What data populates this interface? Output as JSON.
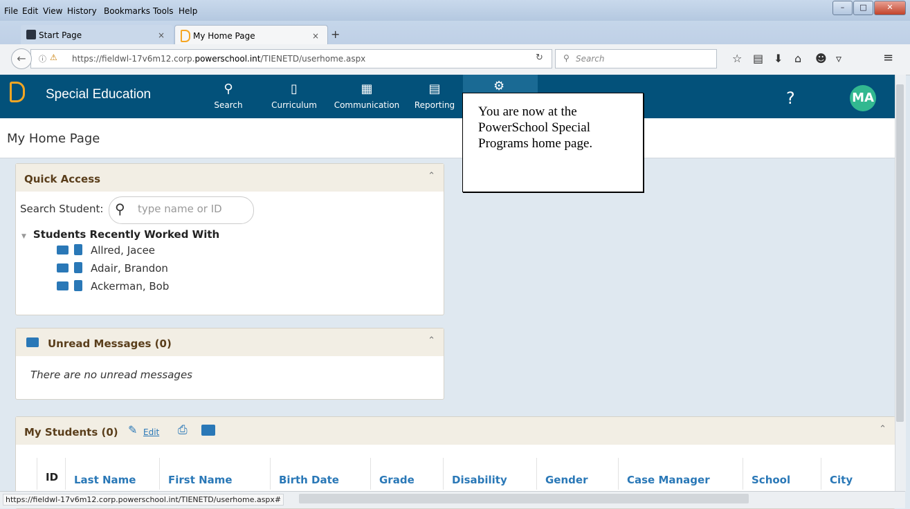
{
  "browser": {
    "menu": [
      "File",
      "Edit",
      "View",
      "History",
      "Bookmarks",
      "Tools",
      "Help"
    ],
    "tabs": [
      {
        "label": "Start Page"
      },
      {
        "label": "My Home Page"
      }
    ],
    "url_prefix": "https://fieldwl-17v6m12.corp.",
    "url_domain": "powerschool.int",
    "url_suffix": "/TIENETD/userhome.aspx",
    "search_placeholder": "Search",
    "status_url": "https://fieldwl-17v6m12.corp.powerschool.int/TIENETD/userhome.aspx#"
  },
  "app": {
    "brand": "Special Education",
    "nav": [
      {
        "label": "Search",
        "icon": "search-icon"
      },
      {
        "label": "Curriculum",
        "icon": "book-icon"
      },
      {
        "label": "Communication",
        "icon": "communication-icon"
      },
      {
        "label": "Reporting",
        "icon": "report-icon"
      }
    ],
    "help": "?",
    "avatar_initials": "MA",
    "colors": {
      "header": "#03517a",
      "accent": "#2a78b7",
      "avatar": "#32b890"
    }
  },
  "page": {
    "title": "My Home Page"
  },
  "quick_access": {
    "title": "Quick Access",
    "search_label": "Search Student:",
    "search_placeholder": "type name or ID",
    "recent_header": "Students Recently Worked With",
    "students": [
      "Allred, Jacee",
      "Adair, Brandon",
      "Ackerman, Bob"
    ]
  },
  "messages": {
    "title": "Unread Messages (0)",
    "empty": "There are no unread messages"
  },
  "my_students": {
    "title": "My Students (0)",
    "edit": "Edit",
    "columns": [
      "ID",
      "Last Name",
      "First Name",
      "Birth Date",
      "Grade",
      "Disability",
      "Gender",
      "Case Manager",
      "School",
      "City"
    ]
  },
  "callout": {
    "text": "You are now at the\nPowerSchool Special\nPrograms home page."
  }
}
